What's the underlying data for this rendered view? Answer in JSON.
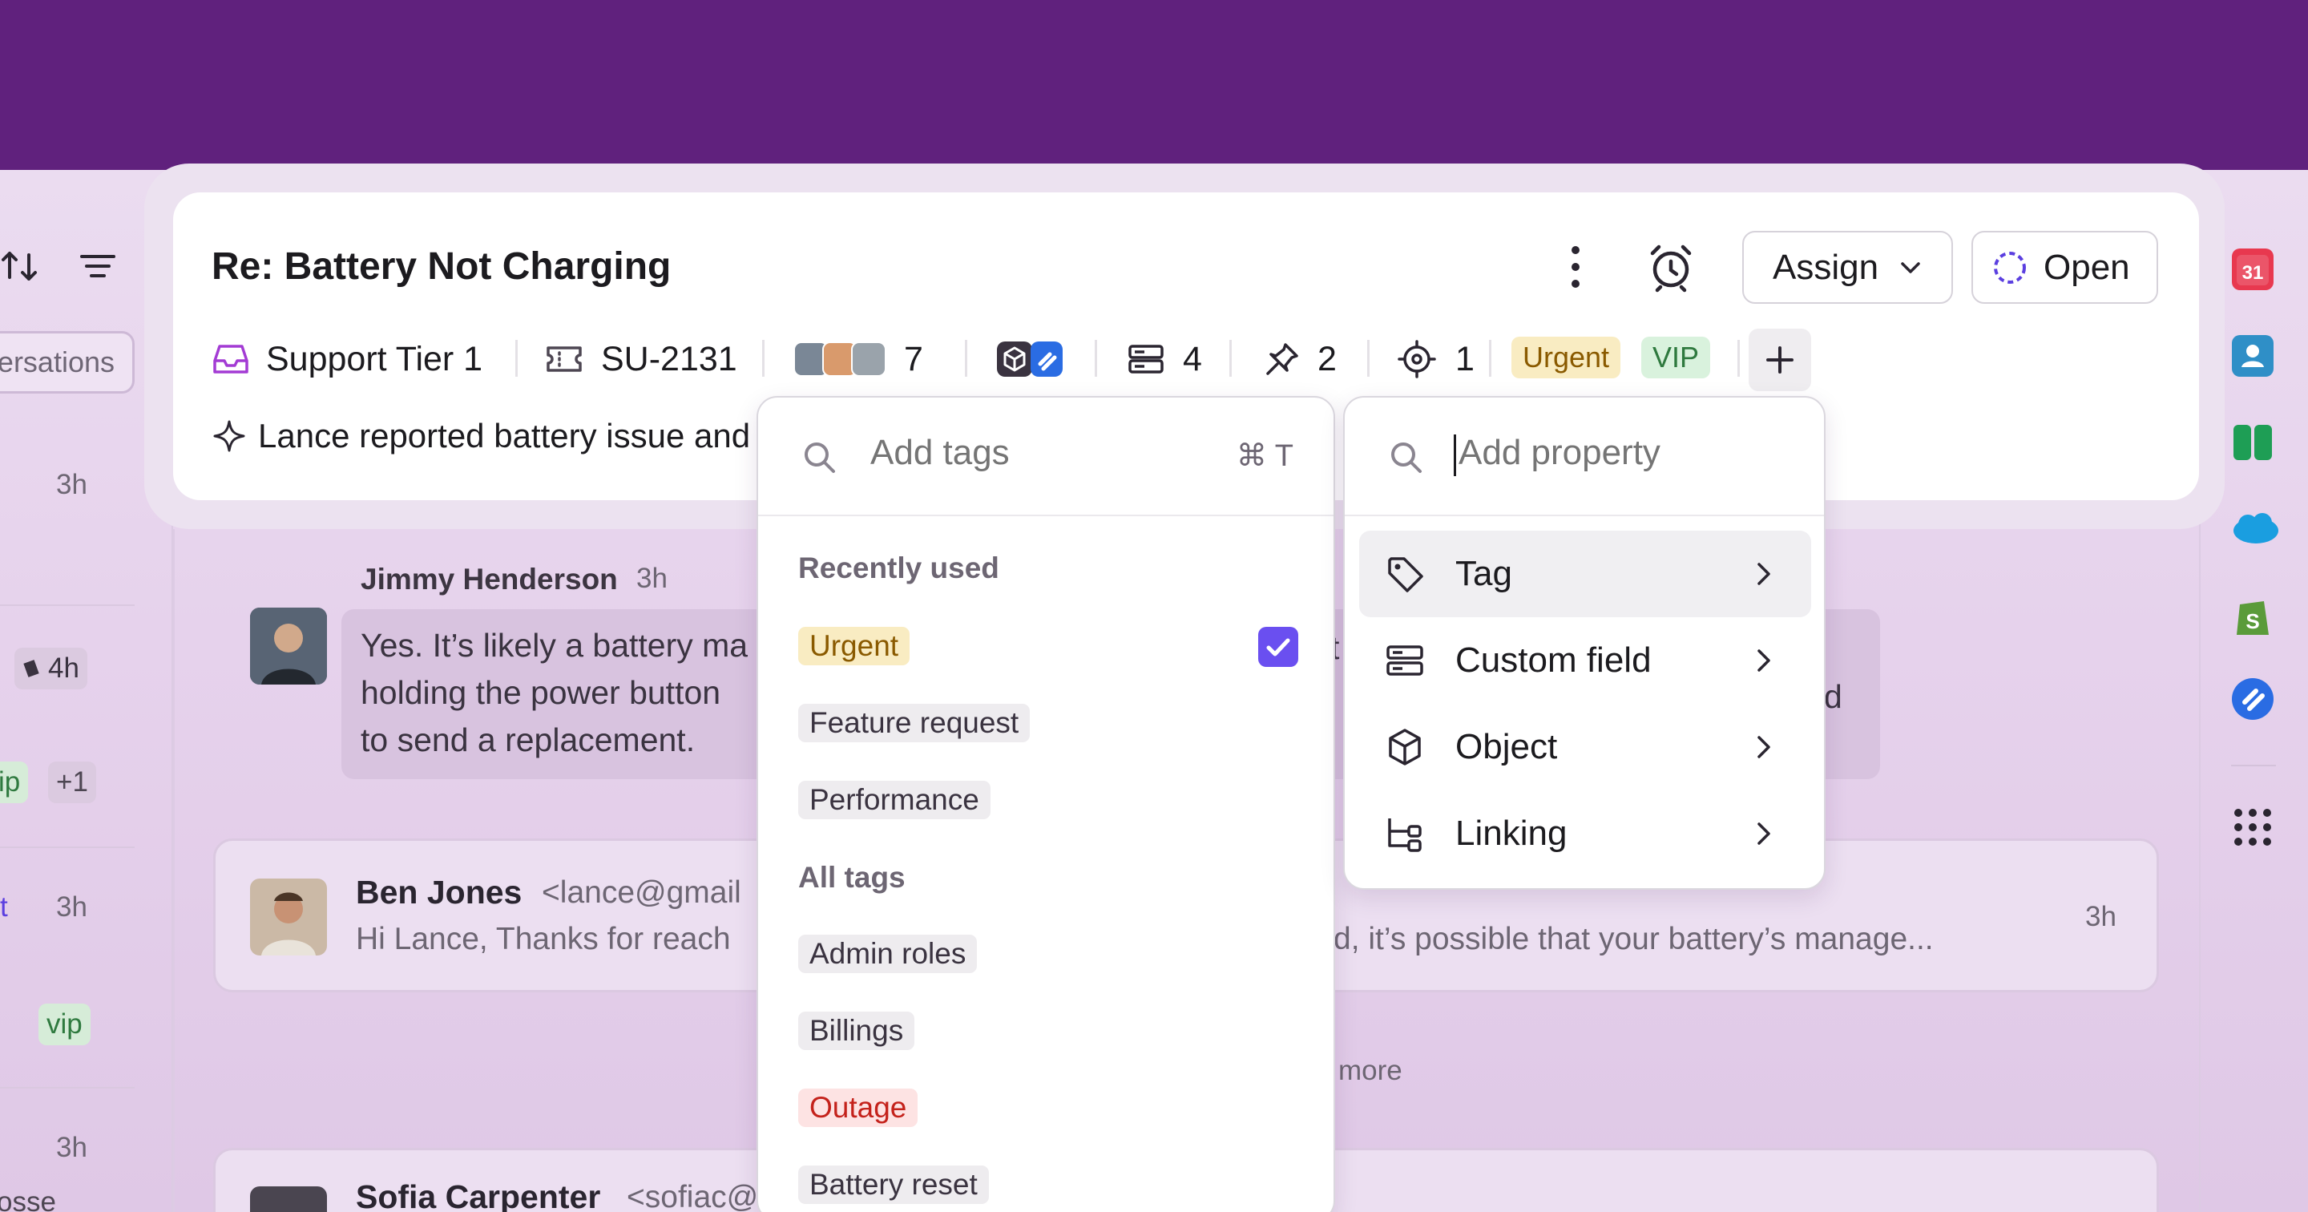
{
  "ticket": {
    "title": "Re: Battery Not Charging",
    "inbox": "Support Tier 1",
    "ticket_id": "SU-2131",
    "participants_count": "7",
    "fields_count": "4",
    "pins_count": "2",
    "tracking_count": "1",
    "tags": [
      "Urgent",
      "VIP"
    ],
    "ai_summary": "Lance reported battery issue and"
  },
  "actions": {
    "assign_label": "Assign",
    "status_label": "Open"
  },
  "left_list": {
    "pill_label": "ersations",
    "times": [
      "3h",
      "4h",
      "3h",
      "3h"
    ],
    "badges": [
      "ip",
      "+1",
      "vip"
    ],
    "link_fragment": "t",
    "bottom_fragment": "osse"
  },
  "thread": {
    "messages": [
      {
        "author": "Jimmy Henderson",
        "time": "3h",
        "body": "Yes. It’s likely a battery ma holding the power button to send a replacement.",
        "lines": [
          "Yes. It’s likely a battery ma",
          "holding the power button",
          "to send a replacement."
        ],
        "tail_fragments": [
          "t",
          "d"
        ]
      },
      {
        "author": "Ben Jones",
        "email": "<lance@gmail",
        "preview_left": "Hi Lance, Thanks for reach",
        "preview_right": "d, it’s possible that your battery’s manage...",
        "time": "3h"
      },
      {
        "author": "Sofia Carpenter",
        "email": "<sofiac@"
      }
    ],
    "more_link": "more"
  },
  "tags_popover": {
    "placeholder": "Add tags",
    "shortcut": "⌘ T",
    "recent_label": "Recently used",
    "recent": [
      {
        "name": "Urgent",
        "checked": true,
        "color": "#f9ecc2",
        "text_color": "#8a5a00"
      },
      {
        "name": "Feature request",
        "checked": false
      },
      {
        "name": "Performance",
        "checked": false
      }
    ],
    "all_label": "All tags",
    "all": [
      {
        "name": "Admin roles"
      },
      {
        "name": "Billings"
      },
      {
        "name": "Outage",
        "color": "#fde3e3",
        "text_color": "#c4221b"
      },
      {
        "name": "Battery reset"
      }
    ]
  },
  "property_popover": {
    "placeholder": "Add property",
    "items": [
      {
        "label": "Tag",
        "icon": "tag-icon",
        "active": true
      },
      {
        "label": "Custom field",
        "icon": "custom-field-icon",
        "active": false
      },
      {
        "label": "Object",
        "icon": "cube-icon",
        "active": false
      },
      {
        "label": "Linking",
        "icon": "link-tree-icon",
        "active": false
      }
    ]
  },
  "sidebar_apps": [
    "google-calendar-icon",
    "contacts-icon",
    "sheets-icon",
    "salesforce-icon",
    "shopify-icon",
    "jira-icon",
    "apps-grid-icon"
  ],
  "colors": {
    "top_band": "#60217d",
    "accent": "#6a4ff0",
    "urgent_bg": "#f9ecc2",
    "vip_bg": "#d9f2dd"
  }
}
